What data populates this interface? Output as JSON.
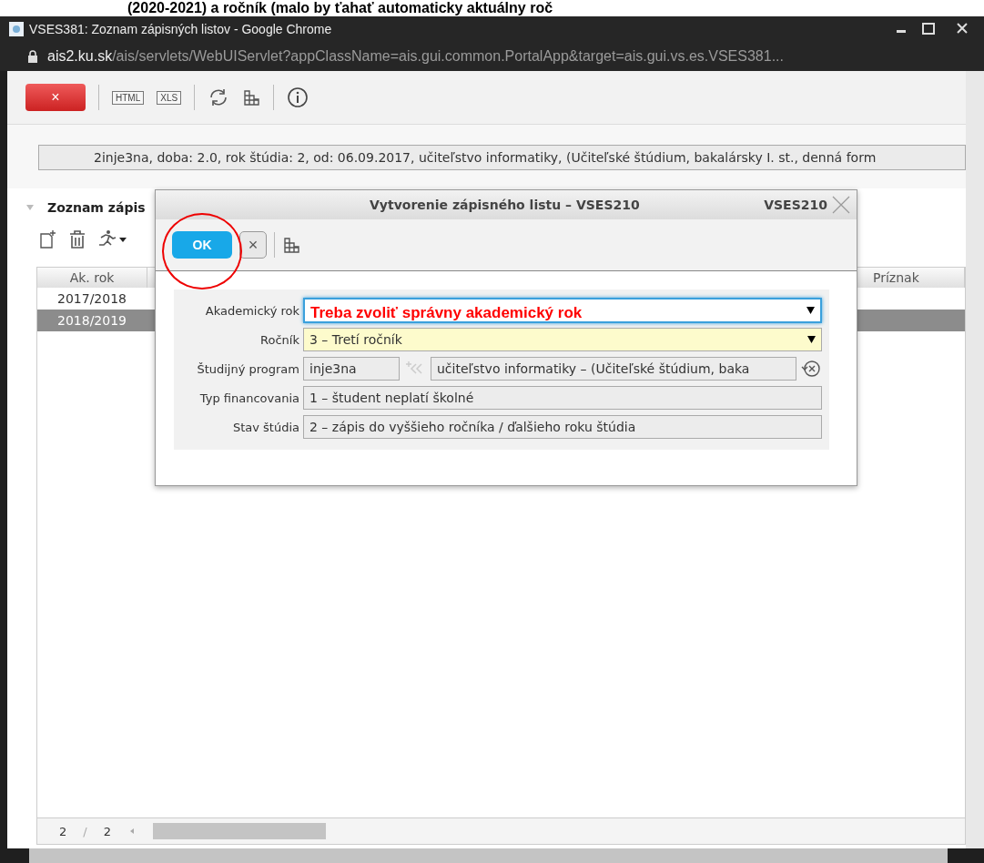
{
  "annotation_top": "(2020-2021) a ročník (malo by ťahať automaticky aktuálny roč",
  "window": {
    "title": "VSES381: Zoznam zápisných listov - Google Chrome"
  },
  "address": {
    "host": "ais2.ku.sk",
    "path": "/ais/servlets/WebUIServlet?appClassName=ais.gui.common.PortalApp&target=ais.gui.vs.es.VSES381..."
  },
  "toolbar": {
    "close_label": "×",
    "export_buttons": [
      "HTML",
      "XLS"
    ]
  },
  "study_info": "2inje3na, doba: 2.0, rok štúdia: 2, od: 06.09.2017, učiteľstvo informatiky, (Učiteľské štúdium, bakalársky I. st., denná form",
  "panel": {
    "title": "Zoznam zápis",
    "expanded": true
  },
  "table": {
    "columns": [
      "Ak. rok",
      "Príznak"
    ],
    "rows": [
      {
        "cells": [
          "2017/2018"
        ],
        "selected": false
      },
      {
        "cells": [
          "2018/2019"
        ],
        "selected": true
      }
    ],
    "pager": {
      "current": "2",
      "separator": "/",
      "total": "2"
    }
  },
  "dialog": {
    "title": "Vytvorenie zápisného listu – VSES210",
    "code": "VSES210",
    "ok_label": "OK",
    "cancel_label": "×",
    "fields": [
      {
        "kind": "select",
        "label": "Akademický rok",
        "annotation": "Treba zvoliť správny akademický rok",
        "focused": true,
        "required": false
      },
      {
        "kind": "select",
        "label": "Ročník",
        "value": "3 – Tretí ročník",
        "focused": false,
        "required": true
      },
      {
        "kind": "program",
        "label": "Študijný program",
        "code": "inje3na",
        "value": "učiteľstvo informatiky – (Učiteľské štúdium, baka"
      },
      {
        "kind": "readonly",
        "label": "Typ financovania",
        "value": "1 – študent neplatí školné"
      },
      {
        "kind": "readonly",
        "label": "Stav štúdia",
        "value": "2 – zápis do vyššieho ročníka / ďalšieho roku štúdia"
      }
    ]
  }
}
